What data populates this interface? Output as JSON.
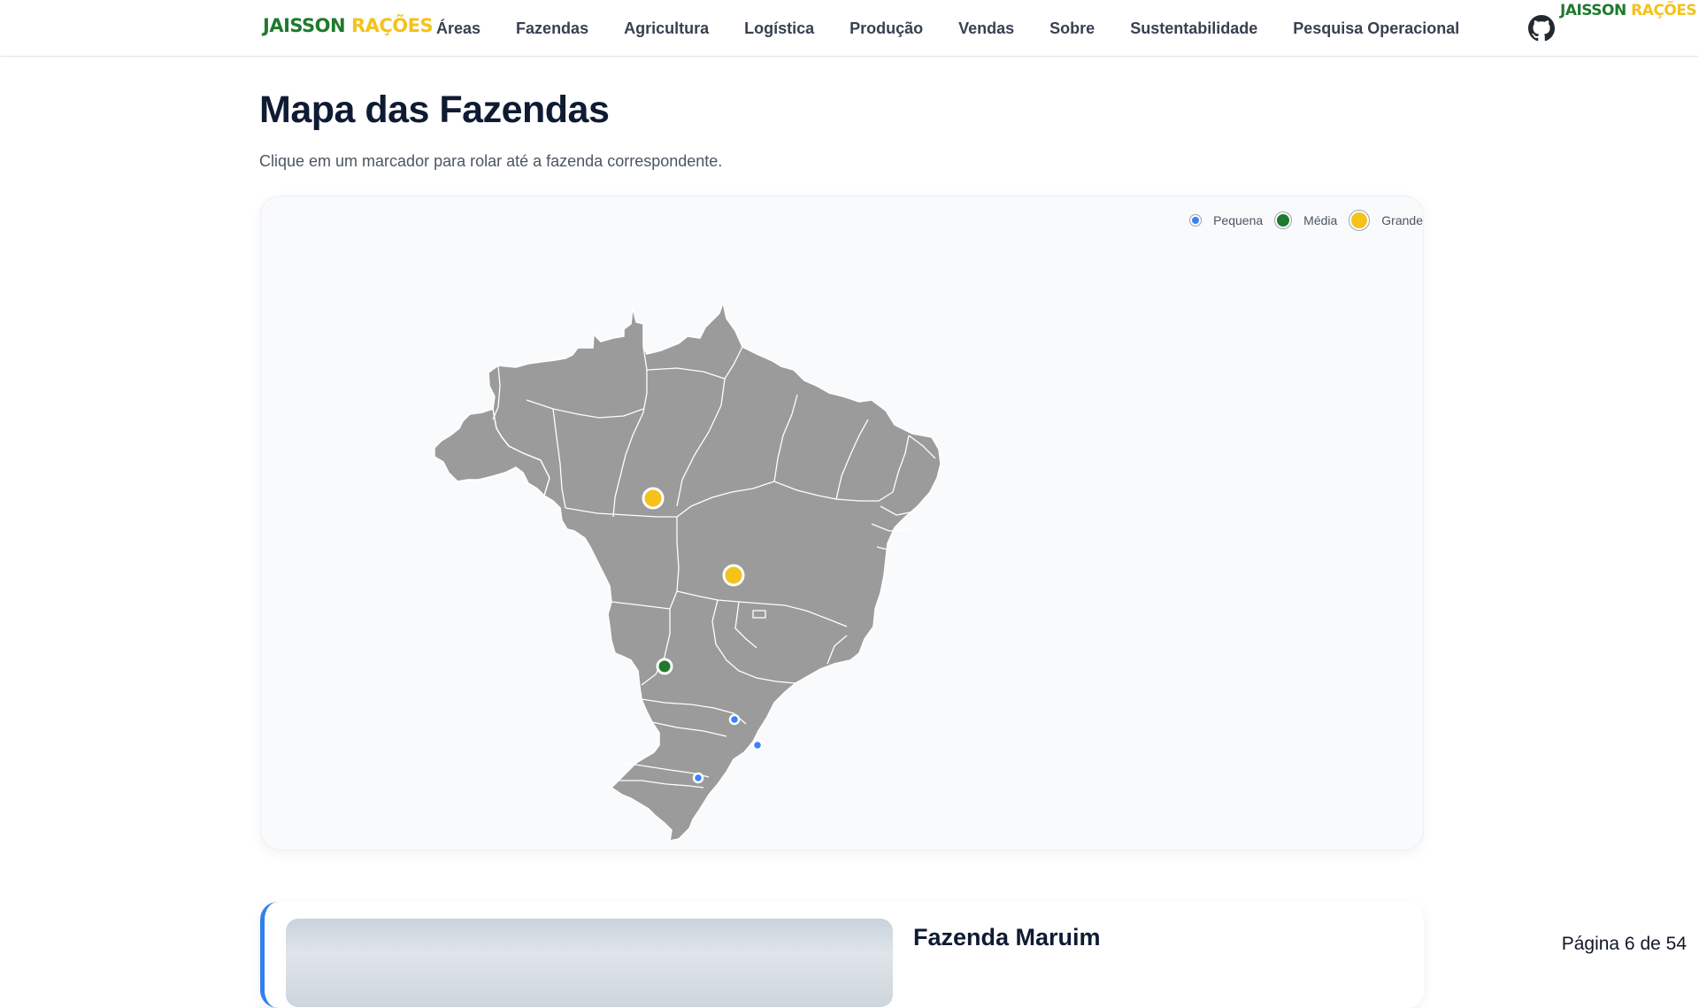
{
  "header": {
    "logo_part1": "JAISSON",
    "logo_part2": "RAÇÕES",
    "nav": [
      "Áreas",
      "Fazendas",
      "Agricultura",
      "Logística",
      "Produção",
      "Vendas",
      "Sobre",
      "Sustentabilidade",
      "Pesquisa Operacional"
    ],
    "github_icon": "github-icon",
    "mini_logo_part1": "JAISSON",
    "mini_logo_part2": "RAÇÕES"
  },
  "main": {
    "title": "Mapa das Fazendas",
    "subtitle": "Clique em um marcador para rolar até a fazenda correspondente."
  },
  "map": {
    "legend": [
      "Pequena",
      "Média",
      "Grande"
    ],
    "colors": {
      "pequena": "#3b82f6",
      "media": "#1f7a2e",
      "grande": "#f4c21b",
      "land": "#9b9b9b"
    },
    "markers": [
      {
        "size": "grande"
      },
      {
        "size": "grande"
      },
      {
        "size": "media"
      },
      {
        "size": "pequena"
      },
      {
        "size": "pequena"
      },
      {
        "size": "pequena"
      }
    ]
  },
  "farm": {
    "name": "Fazenda Maruim"
  },
  "pagination": "Página 6 de 54"
}
